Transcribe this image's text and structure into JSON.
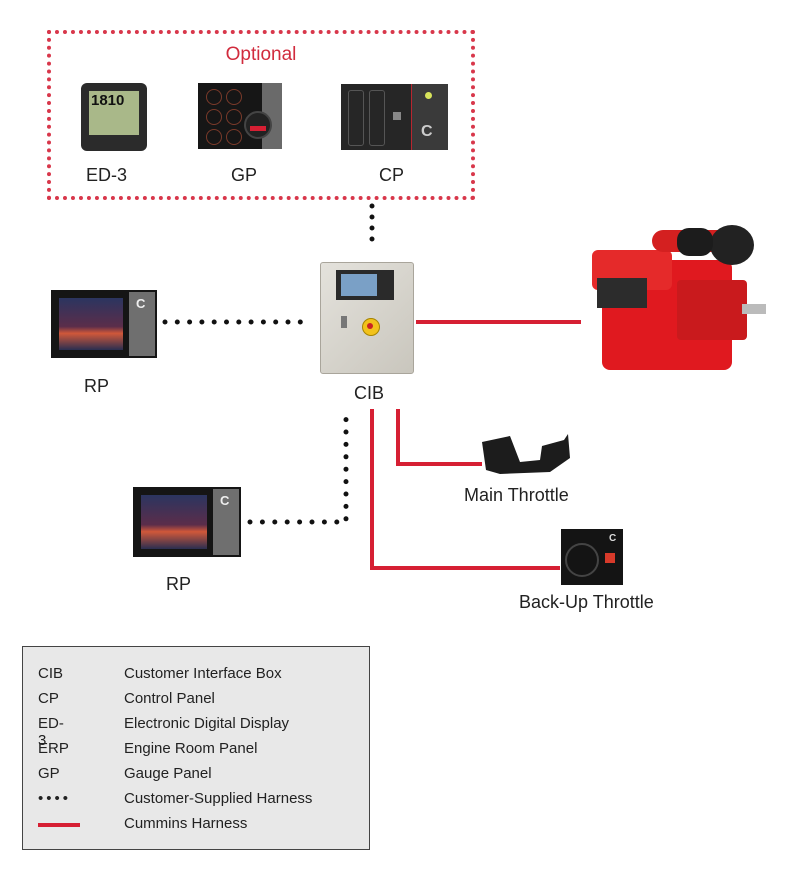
{
  "diagram": {
    "optional_group": {
      "title": "Optional",
      "devices": [
        {
          "label": "ED-3",
          "display_value": "1810"
        },
        {
          "label": "GP"
        },
        {
          "label": "CP"
        }
      ]
    },
    "cib": {
      "label": "CIB"
    },
    "engine": {
      "label": ""
    },
    "remote_panels": [
      {
        "label": "RP"
      },
      {
        "label": "RP"
      }
    ],
    "throttles": {
      "main": {
        "label": "Main Throttle"
      },
      "backup": {
        "label": "Back-Up Throttle"
      }
    },
    "colors": {
      "cummins_harness": "#d61f33",
      "customer_harness": "#111111",
      "optional_border": "#d8374b"
    },
    "connections": [
      {
        "from": "optional_group",
        "to": "CIB",
        "type": "customer-supplied"
      },
      {
        "from": "RP",
        "to": "CIB",
        "type": "customer-supplied"
      },
      {
        "from": "RP",
        "to": "CIB",
        "type": "customer-supplied"
      },
      {
        "from": "CIB",
        "to": "engine",
        "type": "cummins"
      },
      {
        "from": "CIB",
        "to": "Main Throttle",
        "type": "cummins"
      },
      {
        "from": "CIB",
        "to": "Back-Up Throttle",
        "type": "cummins"
      }
    ]
  },
  "legend": {
    "rows": [
      {
        "abbr": "CIB",
        "desc": "Customer Interface Box"
      },
      {
        "abbr": "CP",
        "desc": "Control Panel"
      },
      {
        "abbr": "ED-3",
        "desc": "Electronic Digital Display"
      },
      {
        "abbr": "ERP",
        "desc": "Engine Room Panel"
      },
      {
        "abbr": "GP",
        "desc": "Gauge Panel"
      },
      {
        "abbr": "••••",
        "desc": "Customer-Supplied Harness"
      },
      {
        "abbr": "",
        "desc": "Cummins Harness"
      }
    ]
  }
}
